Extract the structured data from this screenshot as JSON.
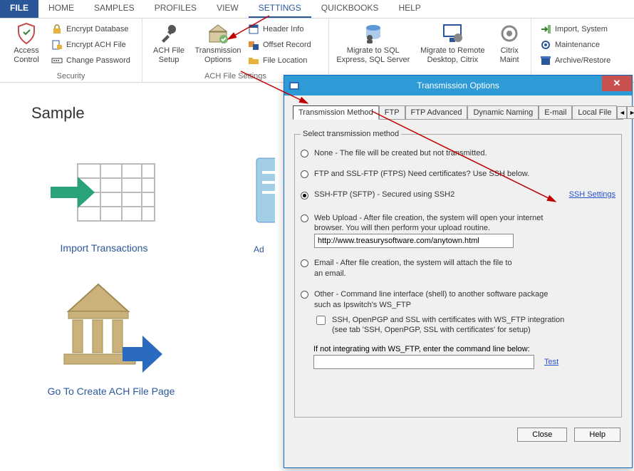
{
  "tabs": {
    "file": "FILE",
    "home": "HOME",
    "samples": "SAMPLES",
    "profiles": "PROFILES",
    "view": "VIEW",
    "settings": "SETTINGS",
    "quickbooks": "QUICKBOOKS",
    "help": "HELP"
  },
  "ribbon": {
    "security": {
      "access_control": "Access\nControl",
      "encrypt_db": "Encrypt Database",
      "encrypt_ach": "Encrypt ACH File",
      "change_pw": "Change Password",
      "group_label": "Security"
    },
    "achfile": {
      "ach_setup": "ACH File\nSetup",
      "trans_opts": "Transmission\nOptions",
      "header_info": "Header Info",
      "offset_record": "Offset Record",
      "file_location": "File Location",
      "group_label": "ACH File Settings"
    },
    "migrate": {
      "sql": "Migrate to SQL\nExpress, SQL Server",
      "remote": "Migrate to Remote\nDesktop, Citrix",
      "citrix": "Citrix\nMaint"
    },
    "misc": {
      "import_system": "Import, System",
      "maintenance": "Maintenance",
      "archive_restore": "Archive/Restore"
    }
  },
  "page": {
    "title": "Sample",
    "tile_import": "Import Transactions",
    "tile_create": "Go To Create ACH File Page",
    "tile_add_prefix": "Ad"
  },
  "dialog": {
    "title": "Transmission Options",
    "close": "✕",
    "tabs": {
      "method": "Transmission Method",
      "ftp": "FTP",
      "ftp_adv": "FTP Advanced",
      "dyn": "Dynamic Naming",
      "email": "E-mail",
      "local": "Local File"
    },
    "legend": "Select transmission method",
    "opts": {
      "none": "None - The file will be created but not transmitted.",
      "ftps": "FTP and SSL-FTP (FTPS) Need certificates? Use SSH below.",
      "sftp": "SSH-FTP (SFTP) - Secured using SSH2",
      "ssh_link": "SSH Settings",
      "web1": "Web Upload - After file creation, the system will open your internet",
      "web2": "browser.  You will then perform your upload routine.",
      "web_url": "http://www.treasurysoftware.com/anytown.html",
      "email1": "Email - After file creation, the system will attach the file to",
      "email2": "an email.",
      "other1": "Other - Command line interface (shell) to another software package",
      "other2": "such as Ipswitch's WS_FTP",
      "chk1": "SSH, OpenPGP and SSL with certificates with WS_FTP integration",
      "chk2": "(see tab 'SSH, OpenPGP, SSL with certificates' for setup)",
      "cmd_label": "If not integrating with WS_FTP, enter the command line below:",
      "test": "Test"
    },
    "btn_close": "Close",
    "btn_help": "Help"
  }
}
